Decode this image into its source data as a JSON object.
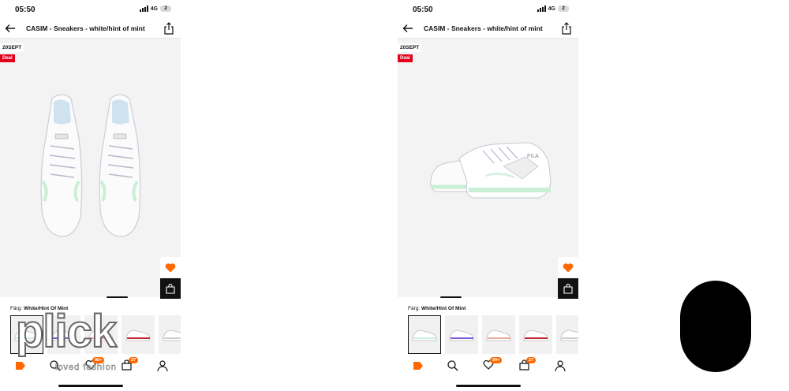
{
  "status_bar": {
    "time": "05:50",
    "network": "4G",
    "battery": "2"
  },
  "header": {
    "title": "CASIM - Sneakers - white/hint of mint"
  },
  "product": {
    "date_flag": "20SEPT",
    "deal_flag": "Deal",
    "color_label": "Färg:",
    "color_value": "White/Hint Of Mint"
  },
  "tabs": {
    "favorites_badge": "99+",
    "bag_badge": "27"
  },
  "watermark": {
    "text": "plick",
    "sub": "loved fashion"
  },
  "colors": {
    "accent": "#ff6900",
    "deal": "#e3001b",
    "bag_button": "#111111"
  }
}
